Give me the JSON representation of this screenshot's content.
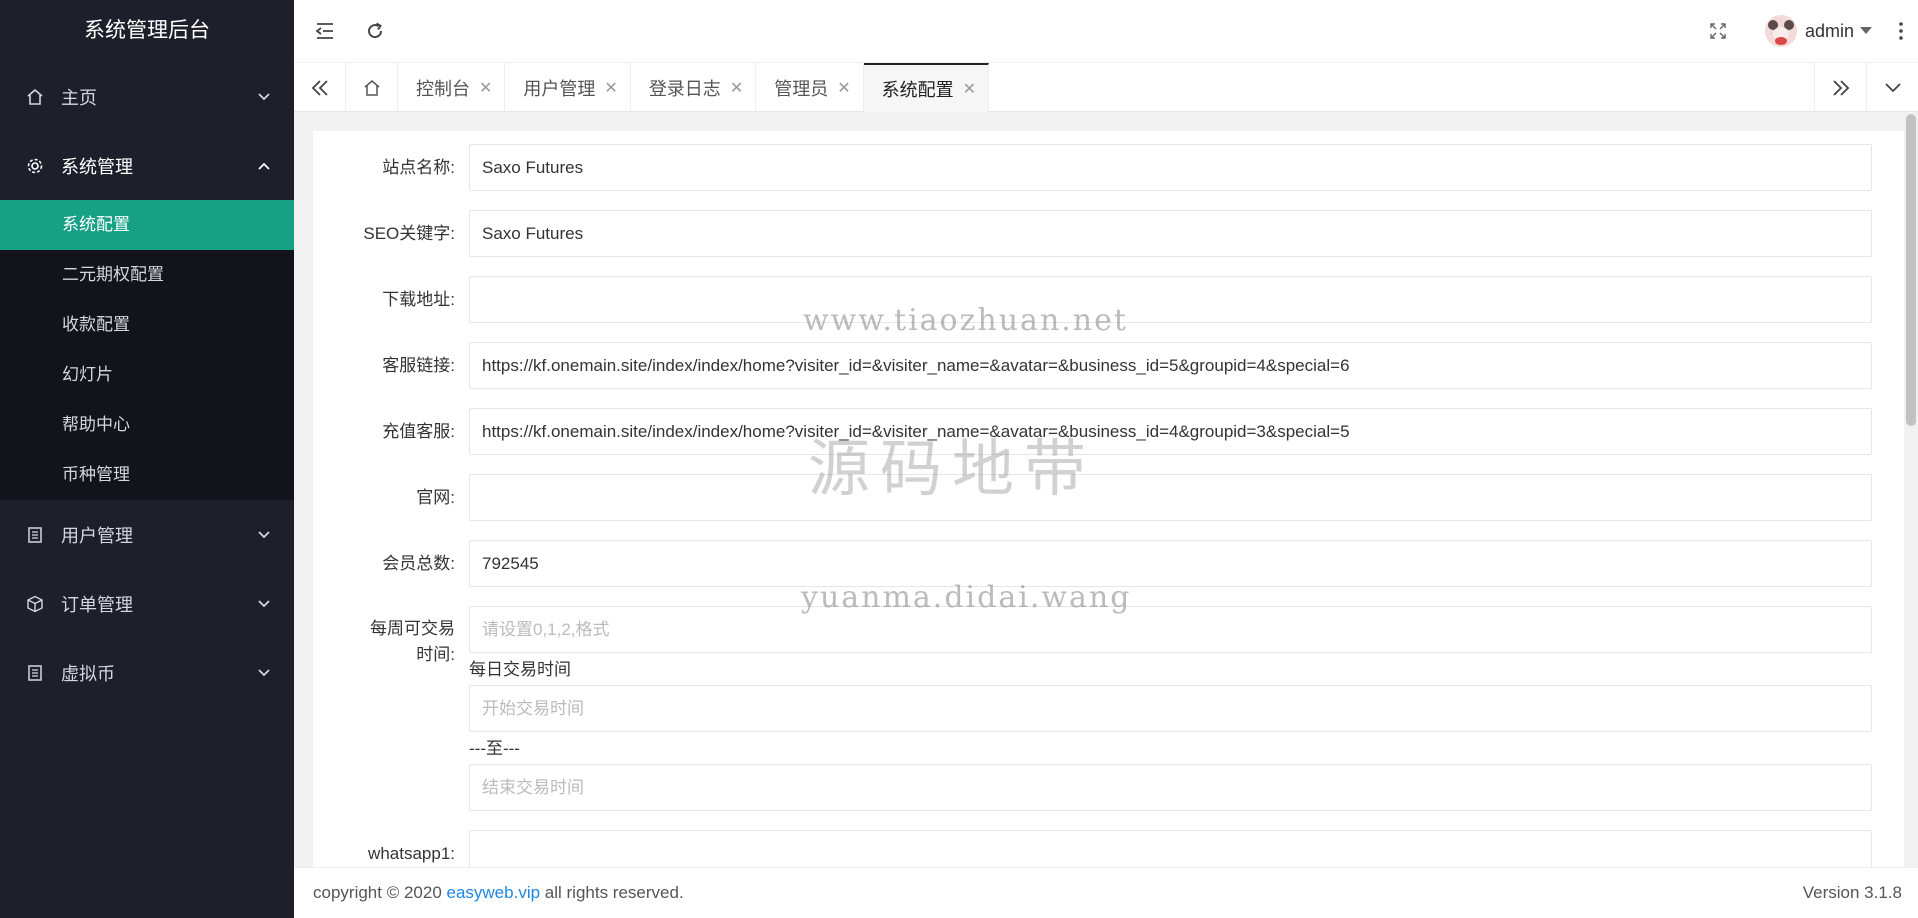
{
  "sidebar": {
    "brand": "系统管理后台",
    "items": [
      {
        "label": "主页",
        "icon": "home-icon",
        "open": false
      },
      {
        "label": "系统管理",
        "icon": "gear-icon",
        "open": true,
        "children": [
          "系统配置",
          "二元期权配置",
          "收款配置",
          "幻灯片",
          "帮助中心",
          "币种管理"
        ],
        "active_child": "系统配置"
      },
      {
        "label": "用户管理",
        "icon": "list-icon",
        "open": false
      },
      {
        "label": "订单管理",
        "icon": "cube-icon",
        "open": false
      },
      {
        "label": "虚拟币",
        "icon": "list-icon",
        "open": false
      }
    ],
    "colors": {
      "bg": "#1f1f2b",
      "active": "#16a085"
    }
  },
  "header": {
    "user_name": "admin"
  },
  "tabs": {
    "items": [
      {
        "label": "控制台"
      },
      {
        "label": "用户管理"
      },
      {
        "label": "登录日志"
      },
      {
        "label": "管理员"
      },
      {
        "label": "系统配置",
        "active": true
      }
    ]
  },
  "form": {
    "site_name": {
      "label": "站点名称:",
      "value": "Saxo Futures"
    },
    "seo_keywords": {
      "label": "SEO关键字:",
      "value": "Saxo Futures"
    },
    "download_url": {
      "label": "下载地址:",
      "value": ""
    },
    "service_link": {
      "label": "客服链接:",
      "value": "https://kf.onemain.site/index/index/home?visiter_id=&visiter_name=&avatar=&business_id=5&groupid=4&special=6"
    },
    "recharge_service": {
      "label": "充值客服:",
      "value": "https://kf.onemain.site/index/index/home?visiter_id=&visiter_name=&avatar=&business_id=4&groupid=3&special=5"
    },
    "official_site": {
      "label": "官网:",
      "value": ""
    },
    "member_total": {
      "label": "会员总数:",
      "value": "792545"
    },
    "weekly_trade": {
      "label_line1": "每周可交易",
      "label_line2": "时间:",
      "value": "",
      "placeholder": "请设置0,1,2,格式"
    },
    "daily_trade_label": "每日交易时间",
    "start_time": {
      "value": "",
      "placeholder": "开始交易时间"
    },
    "to_label": "---至---",
    "end_time": {
      "value": "",
      "placeholder": "结束交易时间"
    },
    "whatsapp1": {
      "label": "whatsapp1:",
      "value": ""
    }
  },
  "footer": {
    "copyright_prefix": "copyright © 2020 ",
    "link_text": "easyweb.vip",
    "copyright_suffix": " all rights reserved.",
    "version": "Version 3.1.8"
  },
  "watermark": {
    "line1": "www.tiaozhuan.net",
    "line2": "源码地带",
    "line3": "yuanma.didai.wang"
  }
}
